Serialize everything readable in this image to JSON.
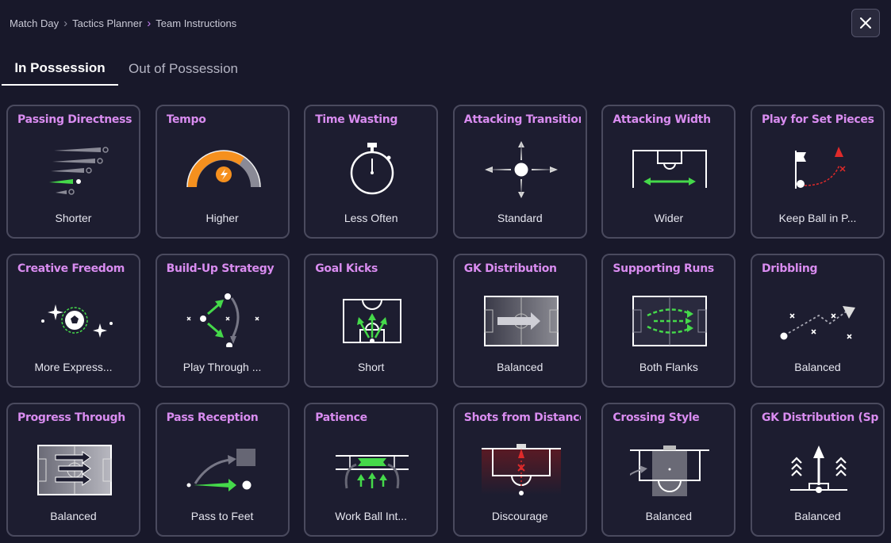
{
  "breadcrumb": [
    "Match Day",
    "Tactics Planner",
    "Team Instructions"
  ],
  "tabs": [
    {
      "label": "In Possession",
      "active": true
    },
    {
      "label": "Out of Possession",
      "active": false
    }
  ],
  "cards": [
    {
      "title": "Passing Directness",
      "value": "Shorter",
      "icon": "passing-directness-icon"
    },
    {
      "title": "Tempo",
      "value": "Higher",
      "icon": "tempo-gauge-icon"
    },
    {
      "title": "Time Wasting",
      "value": "Less Often",
      "icon": "stopwatch-icon"
    },
    {
      "title": "Attacking Transition",
      "value": "Standard",
      "icon": "transition-arrows-icon"
    },
    {
      "title": "Attacking Width",
      "value": "Wider",
      "icon": "pitch-width-icon"
    },
    {
      "title": "Play for Set Pieces",
      "value": "Keep Ball in P...",
      "icon": "corner-flag-icon"
    },
    {
      "title": "Creative Freedom",
      "value": "More Express...",
      "icon": "sparkle-ball-icon"
    },
    {
      "title": "Build-Up Strategy",
      "value": "Play Through ...",
      "icon": "build-up-icon"
    },
    {
      "title": "Goal Kicks",
      "value": "Short",
      "icon": "goal-kick-icon"
    },
    {
      "title": "GK Distribution",
      "value": "Balanced",
      "icon": "gk-distribution-icon"
    },
    {
      "title": "Supporting Runs",
      "value": "Both Flanks",
      "icon": "supporting-runs-icon"
    },
    {
      "title": "Dribbling",
      "value": "Balanced",
      "icon": "dribbling-icon"
    },
    {
      "title": "Progress Through",
      "value": "Balanced",
      "icon": "progress-through-icon"
    },
    {
      "title": "Pass Reception",
      "value": "Pass to Feet",
      "icon": "pass-reception-icon"
    },
    {
      "title": "Patience",
      "value": "Work Ball Int...",
      "icon": "patience-icon"
    },
    {
      "title": "Shots from Distance",
      "value": "Discourage",
      "icon": "shots-distance-icon"
    },
    {
      "title": "Crossing Style",
      "value": "Balanced",
      "icon": "crossing-style-icon"
    },
    {
      "title": "GK Distribution (Speed",
      "value": "Balanced",
      "icon": "gk-speed-icon"
    }
  ],
  "colors": {
    "accent": "#d98cf0",
    "green": "#45d94a",
    "orange": "#f5901e",
    "red": "#e02a2a"
  }
}
